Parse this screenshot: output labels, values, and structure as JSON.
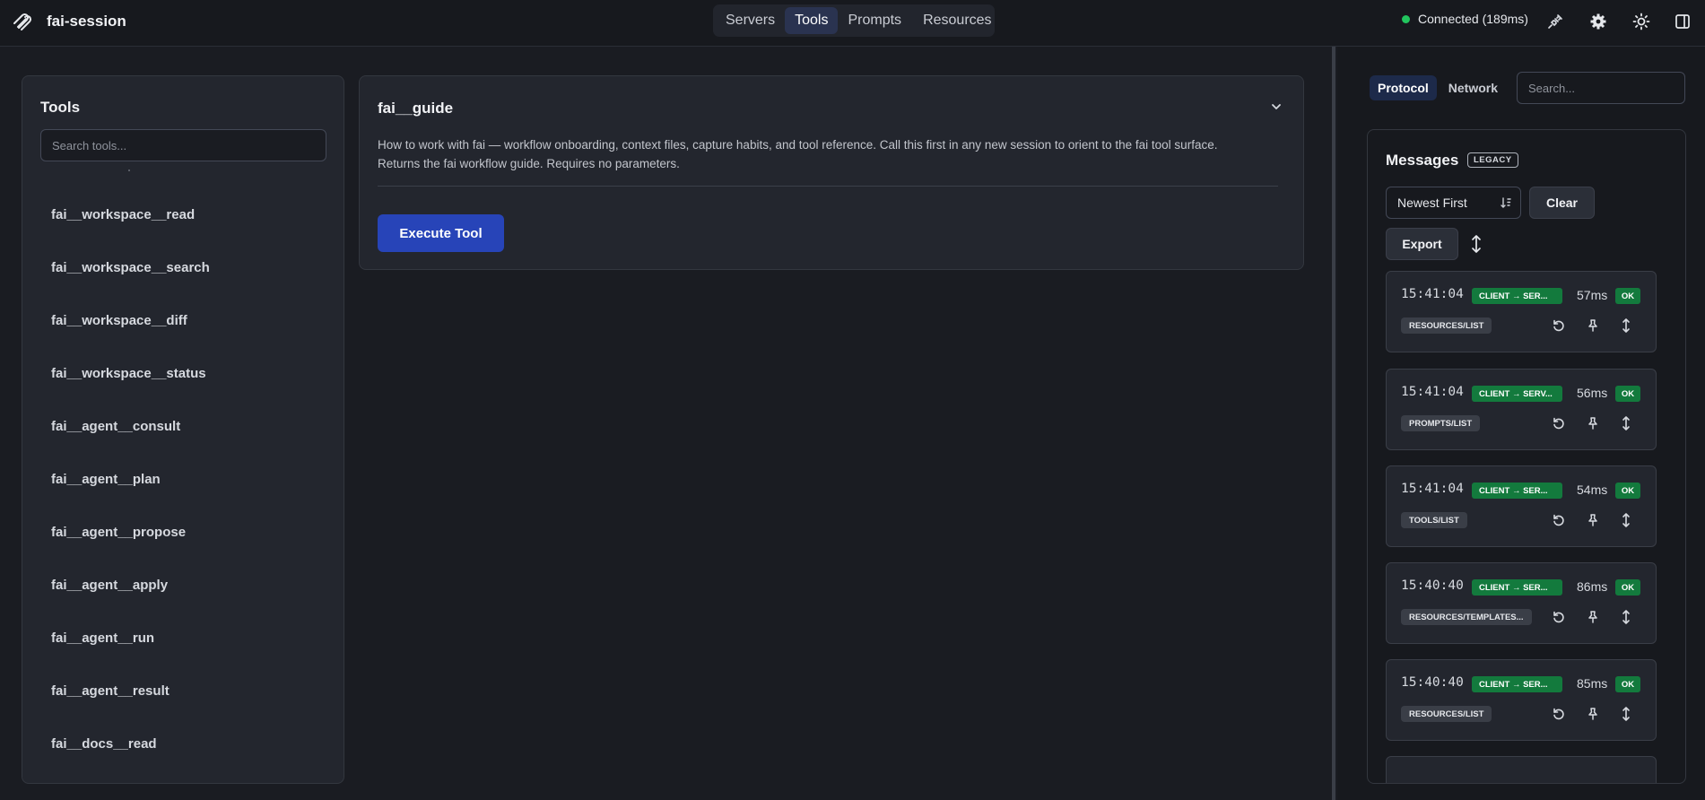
{
  "app": {
    "name": "fai-session",
    "logo_icon": "paperclip-logo-icon"
  },
  "nav": {
    "tabs": [
      "Servers",
      "Tools",
      "Prompts",
      "Resources"
    ],
    "active": "Tools"
  },
  "status": {
    "text": "Connected (189ms)",
    "color": "#22c55e"
  },
  "top_icons": [
    "plug-icon",
    "gear-icon",
    "sun-icon",
    "sidebar-toggle-icon"
  ],
  "tools_panel": {
    "title": "Tools",
    "search_placeholder": "Search tools...",
    "items": [
      "fai__workspace__read",
      "fai__workspace__search",
      "fai__workspace__diff",
      "fai__workspace__status",
      "fai__agent__consult",
      "fai__agent__plan",
      "fai__agent__propose",
      "fai__agent__apply",
      "fai__agent__run",
      "fai__agent__result",
      "fai__docs__read"
    ]
  },
  "tool_detail": {
    "title": "fai__guide",
    "description_line1": "How to work with fai — workflow onboarding, context files, capture habits, and tool reference. Call this first in any new session to orient to the fai tool surface.",
    "description_line2": "Returns the fai workflow guide. Requires no parameters.",
    "execute_label": "Execute Tool",
    "accent_color": "#2744b8"
  },
  "right_panel": {
    "tabs": [
      "Protocol",
      "Network"
    ],
    "active_tab": "Protocol",
    "search_placeholder": "Search..."
  },
  "messages": {
    "title": "Messages",
    "badge": "LEGACY",
    "sort_value": "Newest First",
    "clear_label": "Clear",
    "export_label": "Export",
    "items": [
      {
        "time": "15:41:04",
        "direction": "CLIENT → SER...",
        "latency": "57ms",
        "status": "OK",
        "method": "RESOURCES/LIST"
      },
      {
        "time": "15:41:04",
        "direction": "CLIENT → SERV...",
        "latency": "56ms",
        "status": "OK",
        "method": "PROMPTS/LIST"
      },
      {
        "time": "15:41:04",
        "direction": "CLIENT → SER...",
        "latency": "54ms",
        "status": "OK",
        "method": "TOOLS/LIST"
      },
      {
        "time": "15:40:40",
        "direction": "CLIENT → SER...",
        "latency": "86ms",
        "status": "OK",
        "method": "RESOURCES/TEMPLATES..."
      },
      {
        "time": "15:40:40",
        "direction": "CLIENT → SER...",
        "latency": "85ms",
        "status": "OK",
        "method": "RESOURCES/LIST"
      }
    ]
  }
}
